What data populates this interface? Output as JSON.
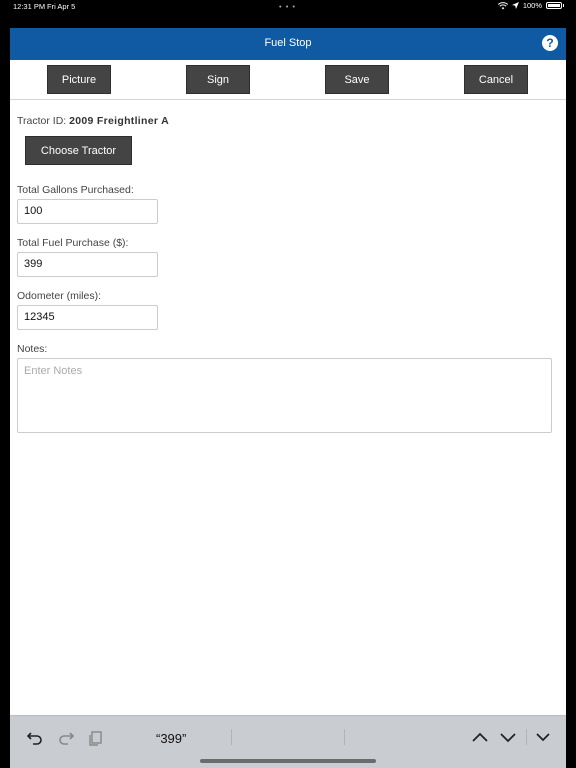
{
  "status_bar": {
    "time": "12:31 PM",
    "date": "Fri Apr 5",
    "battery": "100%"
  },
  "header": {
    "title": "Fuel Stop",
    "help_glyph": "?"
  },
  "toolbar": {
    "picture_label": "Picture",
    "sign_label": "Sign",
    "save_label": "Save",
    "cancel_label": "Cancel"
  },
  "form": {
    "tractor_label": "Tractor ID:",
    "tractor_value": "2009 Freightliner A",
    "choose_tractor_label": "Choose Tractor",
    "gallons_label": "Total Gallons Purchased:",
    "gallons_value": "100",
    "purchase_label": "Total Fuel Purchase ($):",
    "purchase_value": "399",
    "odometer_label": "Odometer (miles):",
    "odometer_value": "12345",
    "notes_label": "Notes:",
    "notes_placeholder": "Enter Notes"
  },
  "keyboard_bar": {
    "suggestion": "“399”",
    "icons": [
      "undo-icon",
      "redo-icon",
      "paste-icon",
      "chevron-up-icon",
      "chevron-down-icon",
      "hide-keyboard-icon"
    ]
  },
  "colors": {
    "header_blue": "#0f5aa3",
    "button_gray": "#444444",
    "keyboard_bar": "#c9ccd1"
  }
}
